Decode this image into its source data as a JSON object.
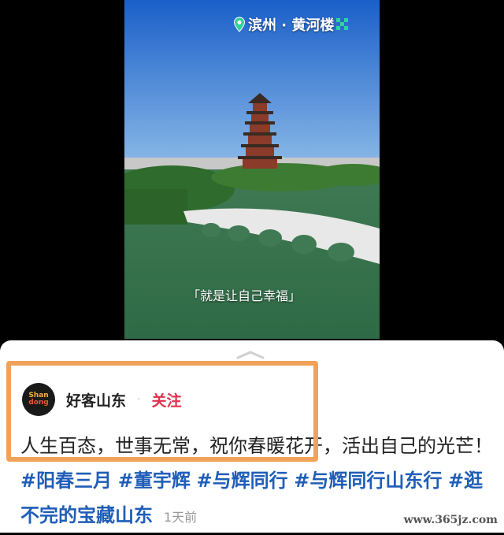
{
  "video": {
    "location_label": "滨州 · 黄河楼",
    "subtitle": "「就是让自己幸福」"
  },
  "post": {
    "author_name": "好客山东",
    "separator": "·",
    "follow_label": "关注",
    "text_prefix": "人生百态，世事无常，祝你春暖花开，活出自己的光芒！",
    "tags": [
      "#阳春三月",
      "#董宇辉",
      "#与辉同行",
      "#与辉同行山东行",
      "#逛不完的宝藏山东"
    ],
    "time": "1天前",
    "avatar_text": [
      "Shan",
      "dong"
    ]
  },
  "watermark": "www.365jz.com",
  "colors": {
    "follow": "#e0304d",
    "tag": "#1f5db8",
    "highlight": "#f1a25a"
  }
}
